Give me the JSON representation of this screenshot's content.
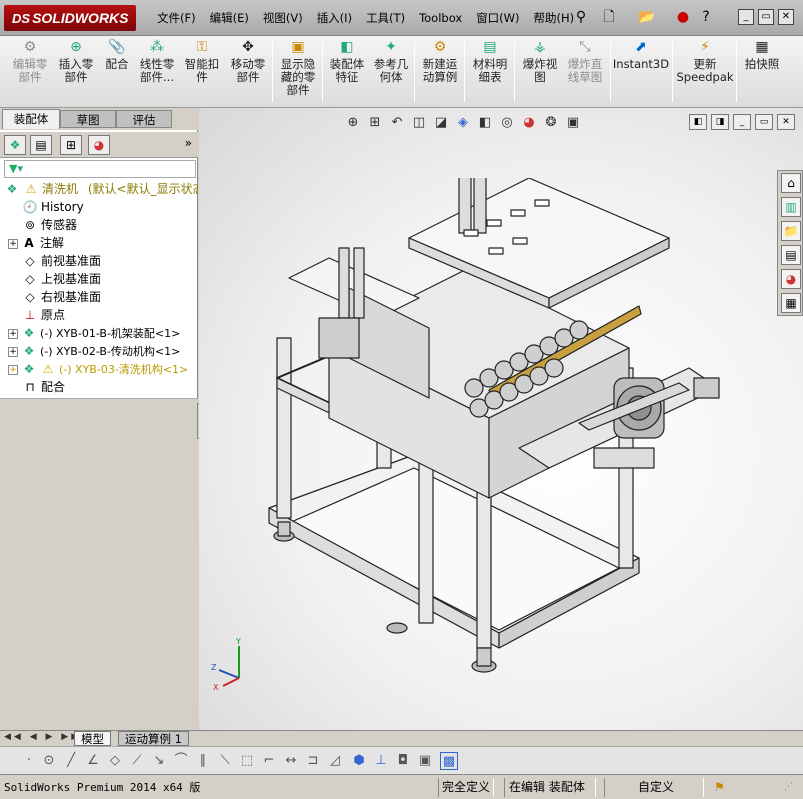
{
  "app": {
    "brand": "SOLIDWORKS",
    "brand_prefix": "DS"
  },
  "menu": [
    "文件(F)",
    "编辑(E)",
    "视图(V)",
    "插入(I)",
    "工具(T)",
    "Toolbox",
    "窗口(W)",
    "帮助(H)"
  ],
  "commands": [
    {
      "label": "编辑零\n部件",
      "icon": "edit-component-icon",
      "disabled": true
    },
    {
      "label": "插入零\n部件",
      "icon": "insert-component-icon",
      "disabled": false
    },
    {
      "label": "配合",
      "icon": "mate-icon",
      "disabled": false
    },
    {
      "label": "线性零\n部件...",
      "icon": "linear-pattern-icon",
      "disabled": false
    },
    {
      "label": "智能扣\n件",
      "icon": "smart-fastener-icon",
      "disabled": false
    },
    {
      "label": "移动零\n部件",
      "icon": "move-component-icon",
      "disabled": false
    },
    {
      "label": "显示隐\n藏的零\n部件",
      "icon": "show-hidden-icon",
      "disabled": false
    },
    {
      "label": "装配体\n特征",
      "icon": "assembly-feature-icon",
      "disabled": false
    },
    {
      "label": "参考几\n何体",
      "icon": "reference-geometry-icon",
      "disabled": false
    },
    {
      "label": "新建运\n动算例",
      "icon": "motion-study-icon",
      "disabled": false
    },
    {
      "label": "材料明\n细表",
      "icon": "bom-icon",
      "disabled": false
    },
    {
      "label": "爆炸视\n图",
      "icon": "exploded-view-icon",
      "disabled": false
    },
    {
      "label": "爆炸直\n线草图",
      "icon": "explode-line-icon",
      "disabled": true
    },
    {
      "label": "Instant3D",
      "icon": "instant3d-icon",
      "disabled": false
    },
    {
      "label": "更新\nSpeedpak",
      "icon": "speedpak-icon",
      "disabled": false
    },
    {
      "label": "拍快照",
      "icon": "snapshot-icon",
      "disabled": false
    }
  ],
  "panel_tabs": [
    "装配体",
    "草图",
    "评估"
  ],
  "tree": {
    "root": "清洗机",
    "root_suffix": "(默认<默认_显示状态",
    "items": [
      {
        "label": "History",
        "icon": "history-icon"
      },
      {
        "label": "传感器",
        "icon": "sensor-icon"
      },
      {
        "label": "注解",
        "icon": "annotation-icon"
      },
      {
        "label": "前视基准面",
        "icon": "plane-icon"
      },
      {
        "label": "上视基准面",
        "icon": "plane-icon"
      },
      {
        "label": "右视基准面",
        "icon": "plane-icon"
      },
      {
        "label": "原点",
        "icon": "origin-icon"
      },
      {
        "label": "(-) XYB-01-B-机架装配<1>",
        "icon": "subassembly-icon"
      },
      {
        "label": "(-) XYB-02-B-传动机构<1>",
        "icon": "subassembly-icon"
      },
      {
        "label": "(-) XYB-03-清洗机构<1>",
        "icon": "subassembly-warning-icon"
      },
      {
        "label": "配合",
        "icon": "mates-folder-icon"
      }
    ]
  },
  "bottom_tabs": [
    "模型",
    "运动算例 1"
  ],
  "status": {
    "product": "SolidWorks Premium 2014 x64 版",
    "definition": "完全定义",
    "mode": "在编辑 装配体",
    "units": "自定义"
  },
  "triad": {
    "x": "X",
    "y": "Y",
    "z": "Z"
  },
  "colors": {
    "brand": "#a80c0e",
    "frame": "#e6e6e6",
    "rail": "#c8a040"
  }
}
